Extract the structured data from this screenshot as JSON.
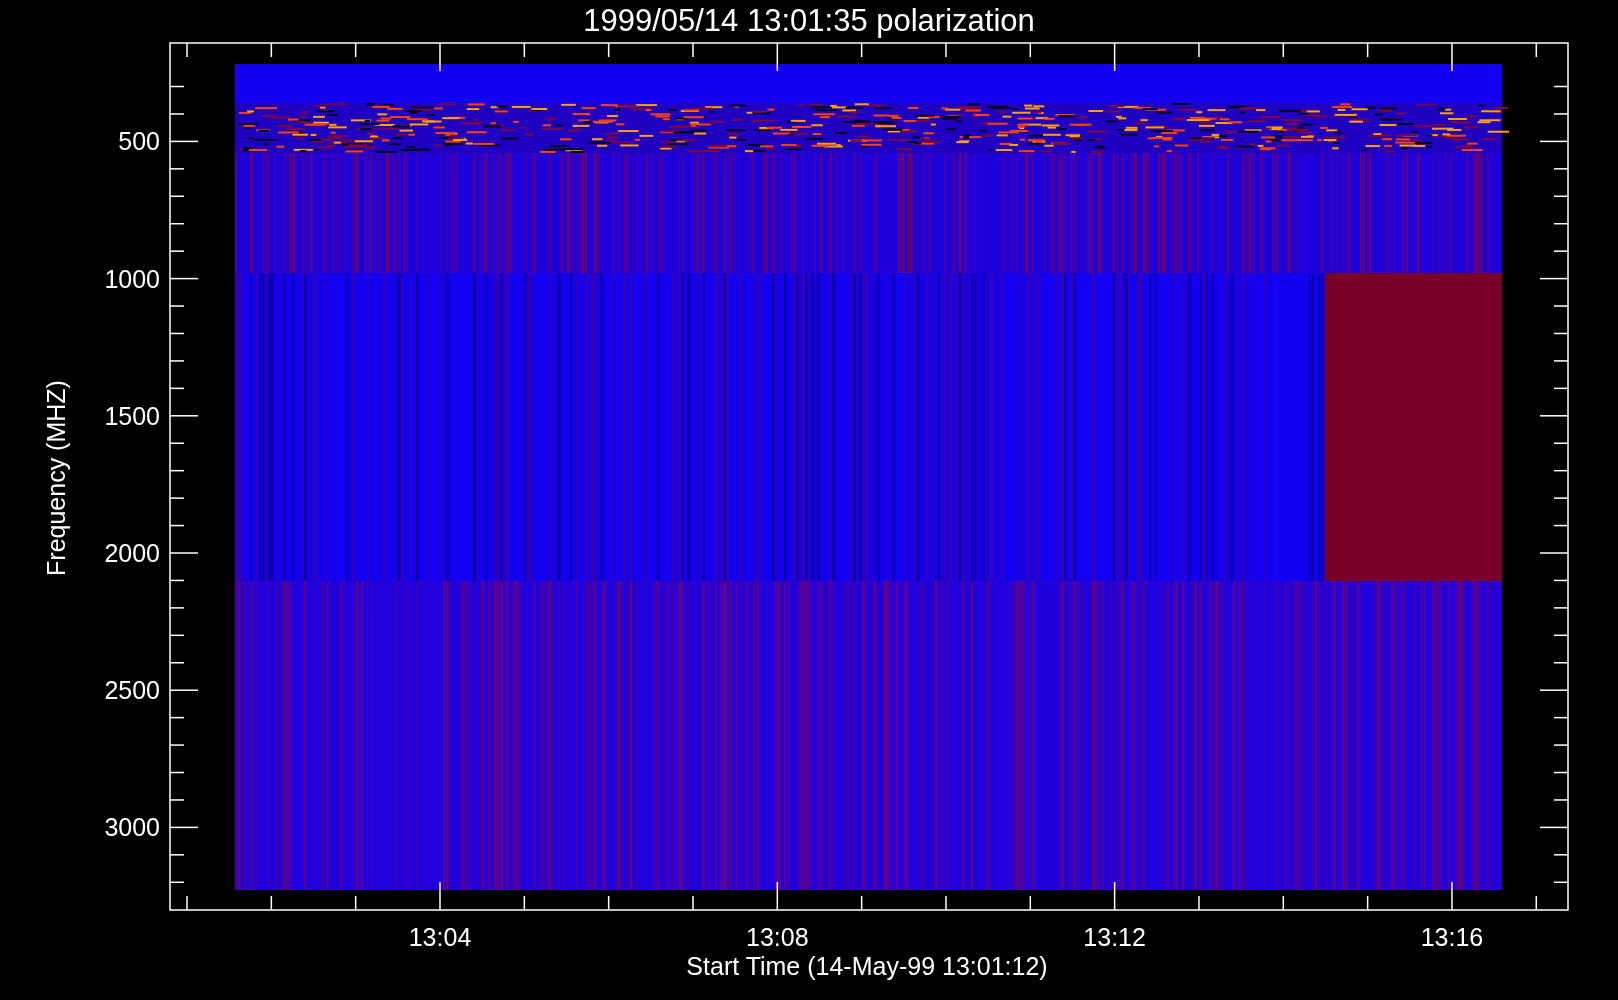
{
  "plot": {
    "title": "1999/05/14 13:01:35 polarization",
    "ylabel": "Frequency (MHZ)",
    "xlabel": "Start Time (14-May-99 13:01:12)",
    "y_tick_labels": [
      "500",
      "1000",
      "1500",
      "2000",
      "2500",
      "3000"
    ],
    "x_tick_labels": [
      "13:04",
      "13:08",
      "13:12",
      "13:16"
    ]
  }
}
